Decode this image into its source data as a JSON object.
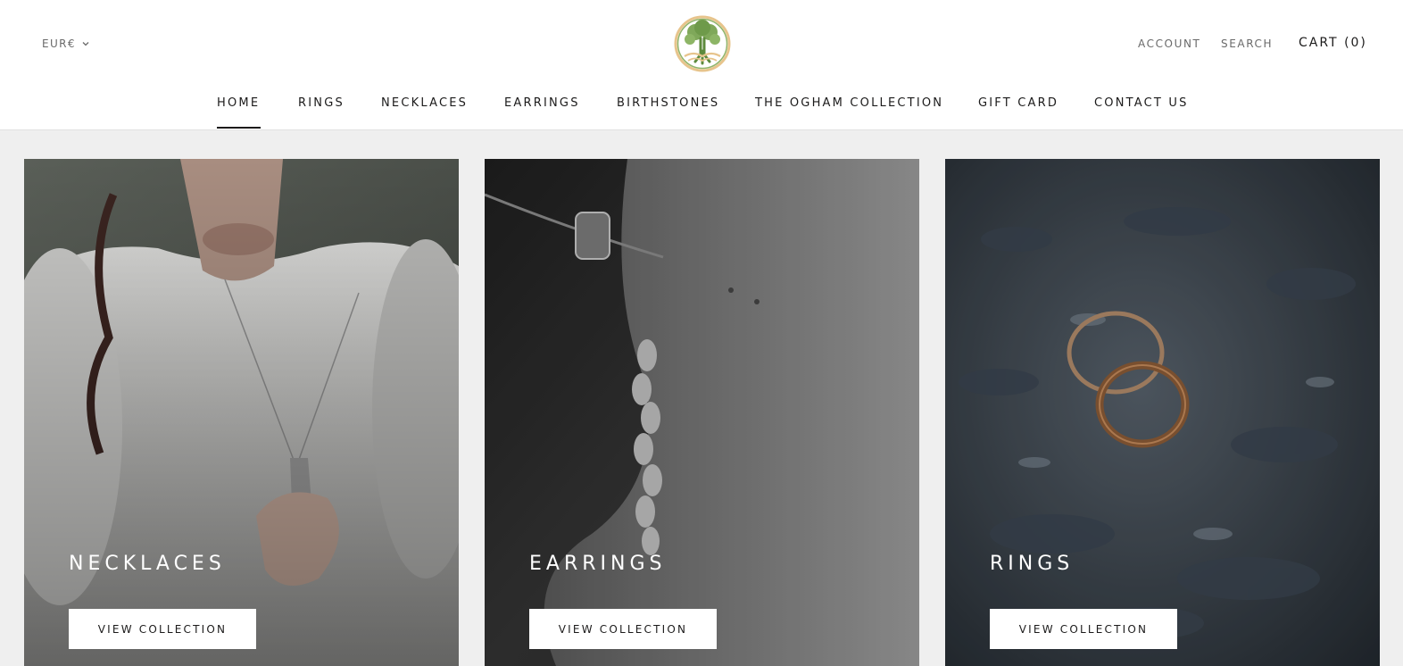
{
  "header": {
    "currency": "EUR€",
    "account": "ACCOUNT",
    "search": "SEARCH",
    "cart": "CART (0)"
  },
  "nav": {
    "items": [
      "HOME",
      "RINGS",
      "NECKLACES",
      "EARRINGS",
      "BIRTHSTONES",
      "THE OGHAM COLLECTION",
      "GIFT CARD",
      "CONTACT US"
    ],
    "active": "HOME"
  },
  "collections": [
    {
      "title": "NECKLACES",
      "button": "VIEW COLLECTION"
    },
    {
      "title": "EARRINGS",
      "button": "VIEW COLLECTION"
    },
    {
      "title": "RINGS",
      "button": "VIEW COLLECTION"
    }
  ],
  "icons": {
    "logo": "tree-of-life-logo",
    "currency_dropdown": "chevron-down-icon"
  }
}
